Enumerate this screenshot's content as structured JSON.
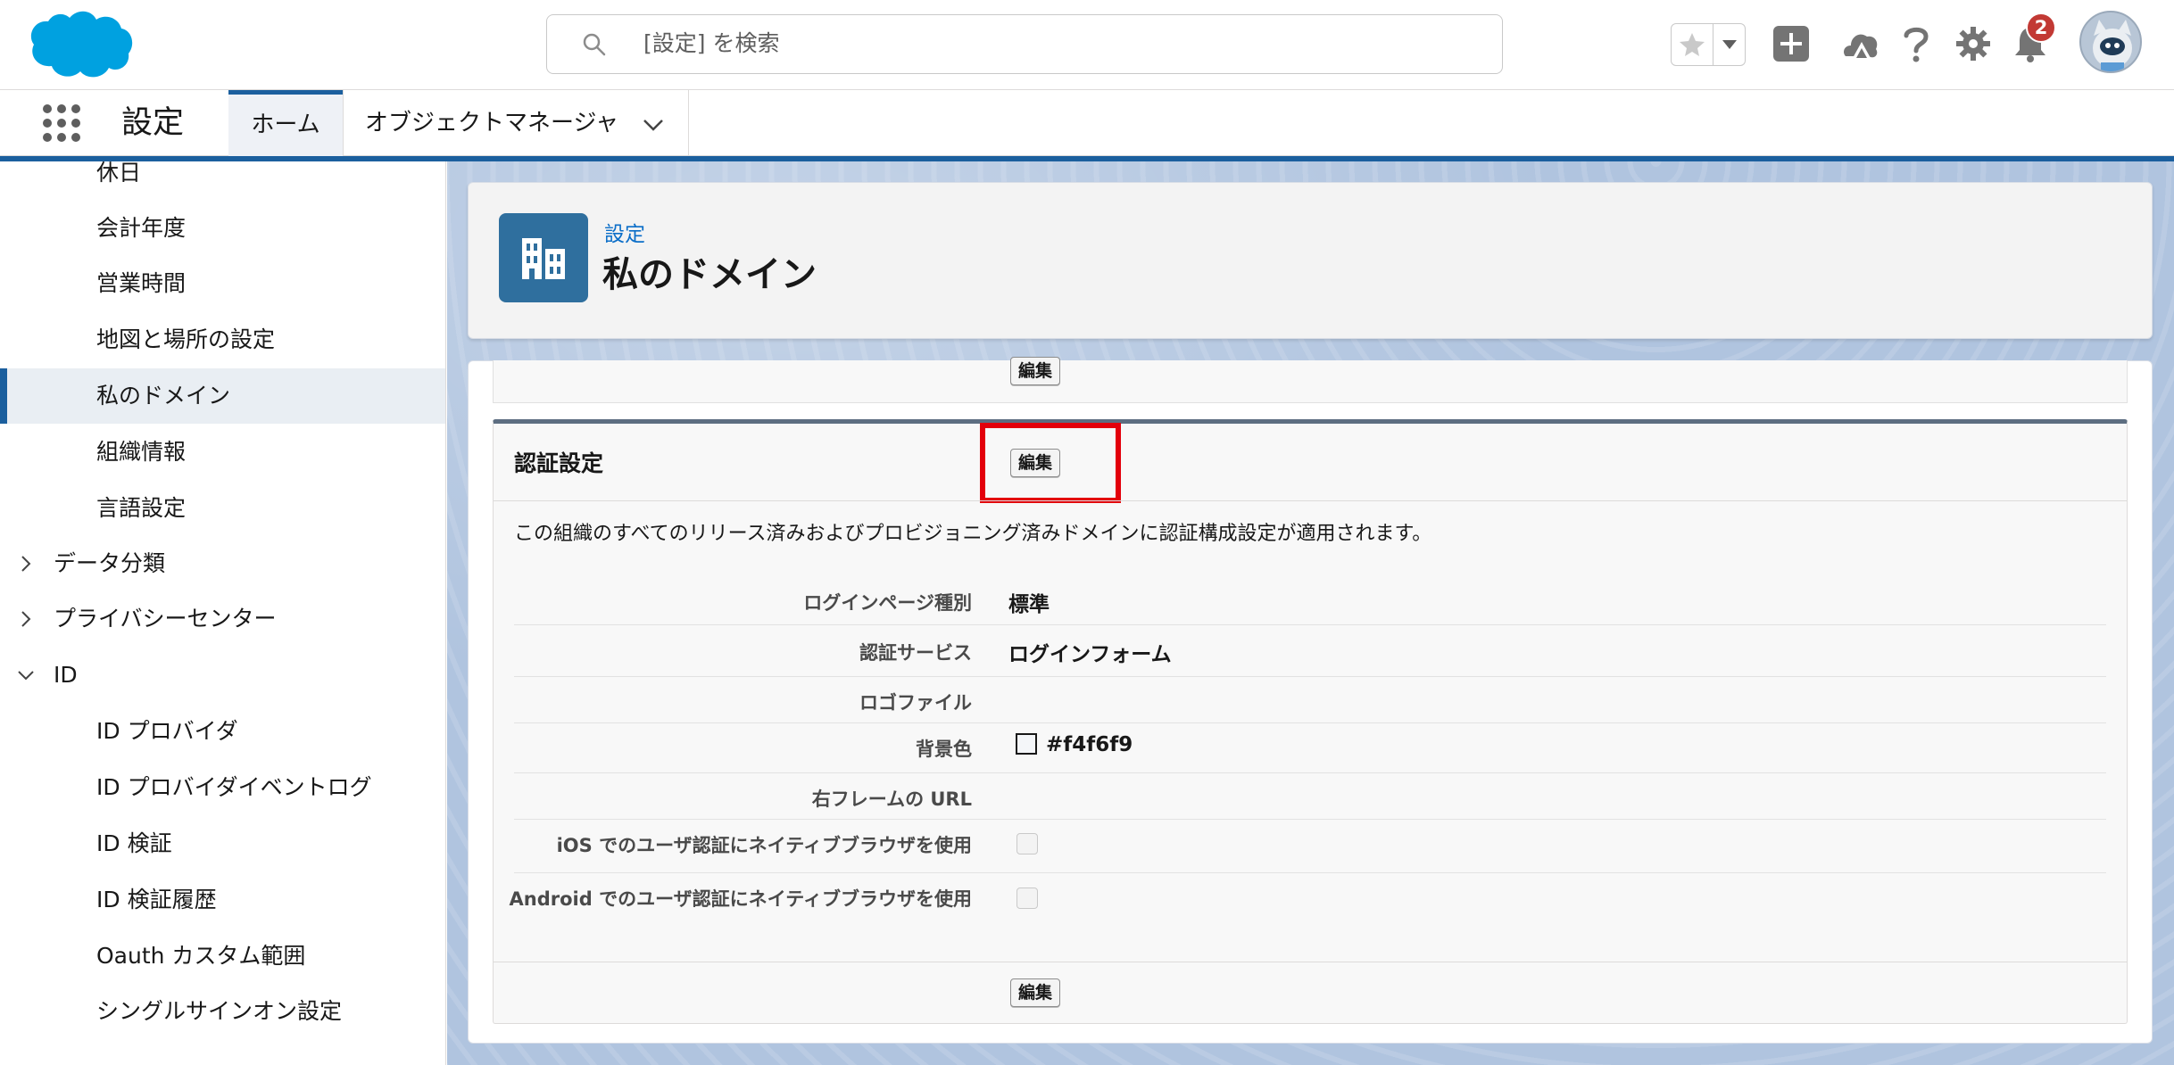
{
  "header": {
    "search_placeholder": "[設定] を検索",
    "notification_count": "2"
  },
  "nav": {
    "app_name": "設定",
    "tabs": [
      {
        "label": "ホーム"
      },
      {
        "label": "オブジェクトマネージャ"
      }
    ]
  },
  "sidebar": {
    "items": [
      {
        "label": "休日"
      },
      {
        "label": "会計年度"
      },
      {
        "label": "営業時間"
      },
      {
        "label": "地図と場所の設定"
      },
      {
        "label": "私のドメイン"
      },
      {
        "label": "組織情報"
      },
      {
        "label": "言語設定"
      },
      {
        "label": "データ分類"
      },
      {
        "label": "プライバシーセンター"
      },
      {
        "label": "ID"
      },
      {
        "label": "ID プロバイダ"
      },
      {
        "label": "ID プロバイダイベントログ"
      },
      {
        "label": "ID 検証"
      },
      {
        "label": "ID 検証履歴"
      },
      {
        "label": "Oauth カスタム範囲"
      },
      {
        "label": "シングルサインオン設定"
      }
    ]
  },
  "page": {
    "breadcrumb": "設定",
    "title": "私のドメイン"
  },
  "section": {
    "edit_label": "編集",
    "title": "認証設定",
    "description": "この組織のすべてのリリース済みおよびプロビジョニング済みドメインに認証構成設定が適用されます。",
    "fields": [
      {
        "label": "ログインページ種別",
        "value": "標準"
      },
      {
        "label": "認証サービス",
        "value": "ログインフォーム"
      },
      {
        "label": "ロゴファイル",
        "value": ""
      },
      {
        "label": "背景色",
        "value": "#f4f6f9"
      },
      {
        "label": "右フレームの URL",
        "value": ""
      },
      {
        "label": "iOS でのユーザ認証にネイティブブラウザを使用",
        "value": ""
      },
      {
        "label": "Android でのユーザ認証にネイティブブラウザを使用",
        "value": ""
      }
    ]
  },
  "colors": {
    "brand": "#1b5f9e",
    "salesforce_cloud": "#00a1e0",
    "highlight": "#e3000b",
    "badge": "#c23934"
  }
}
